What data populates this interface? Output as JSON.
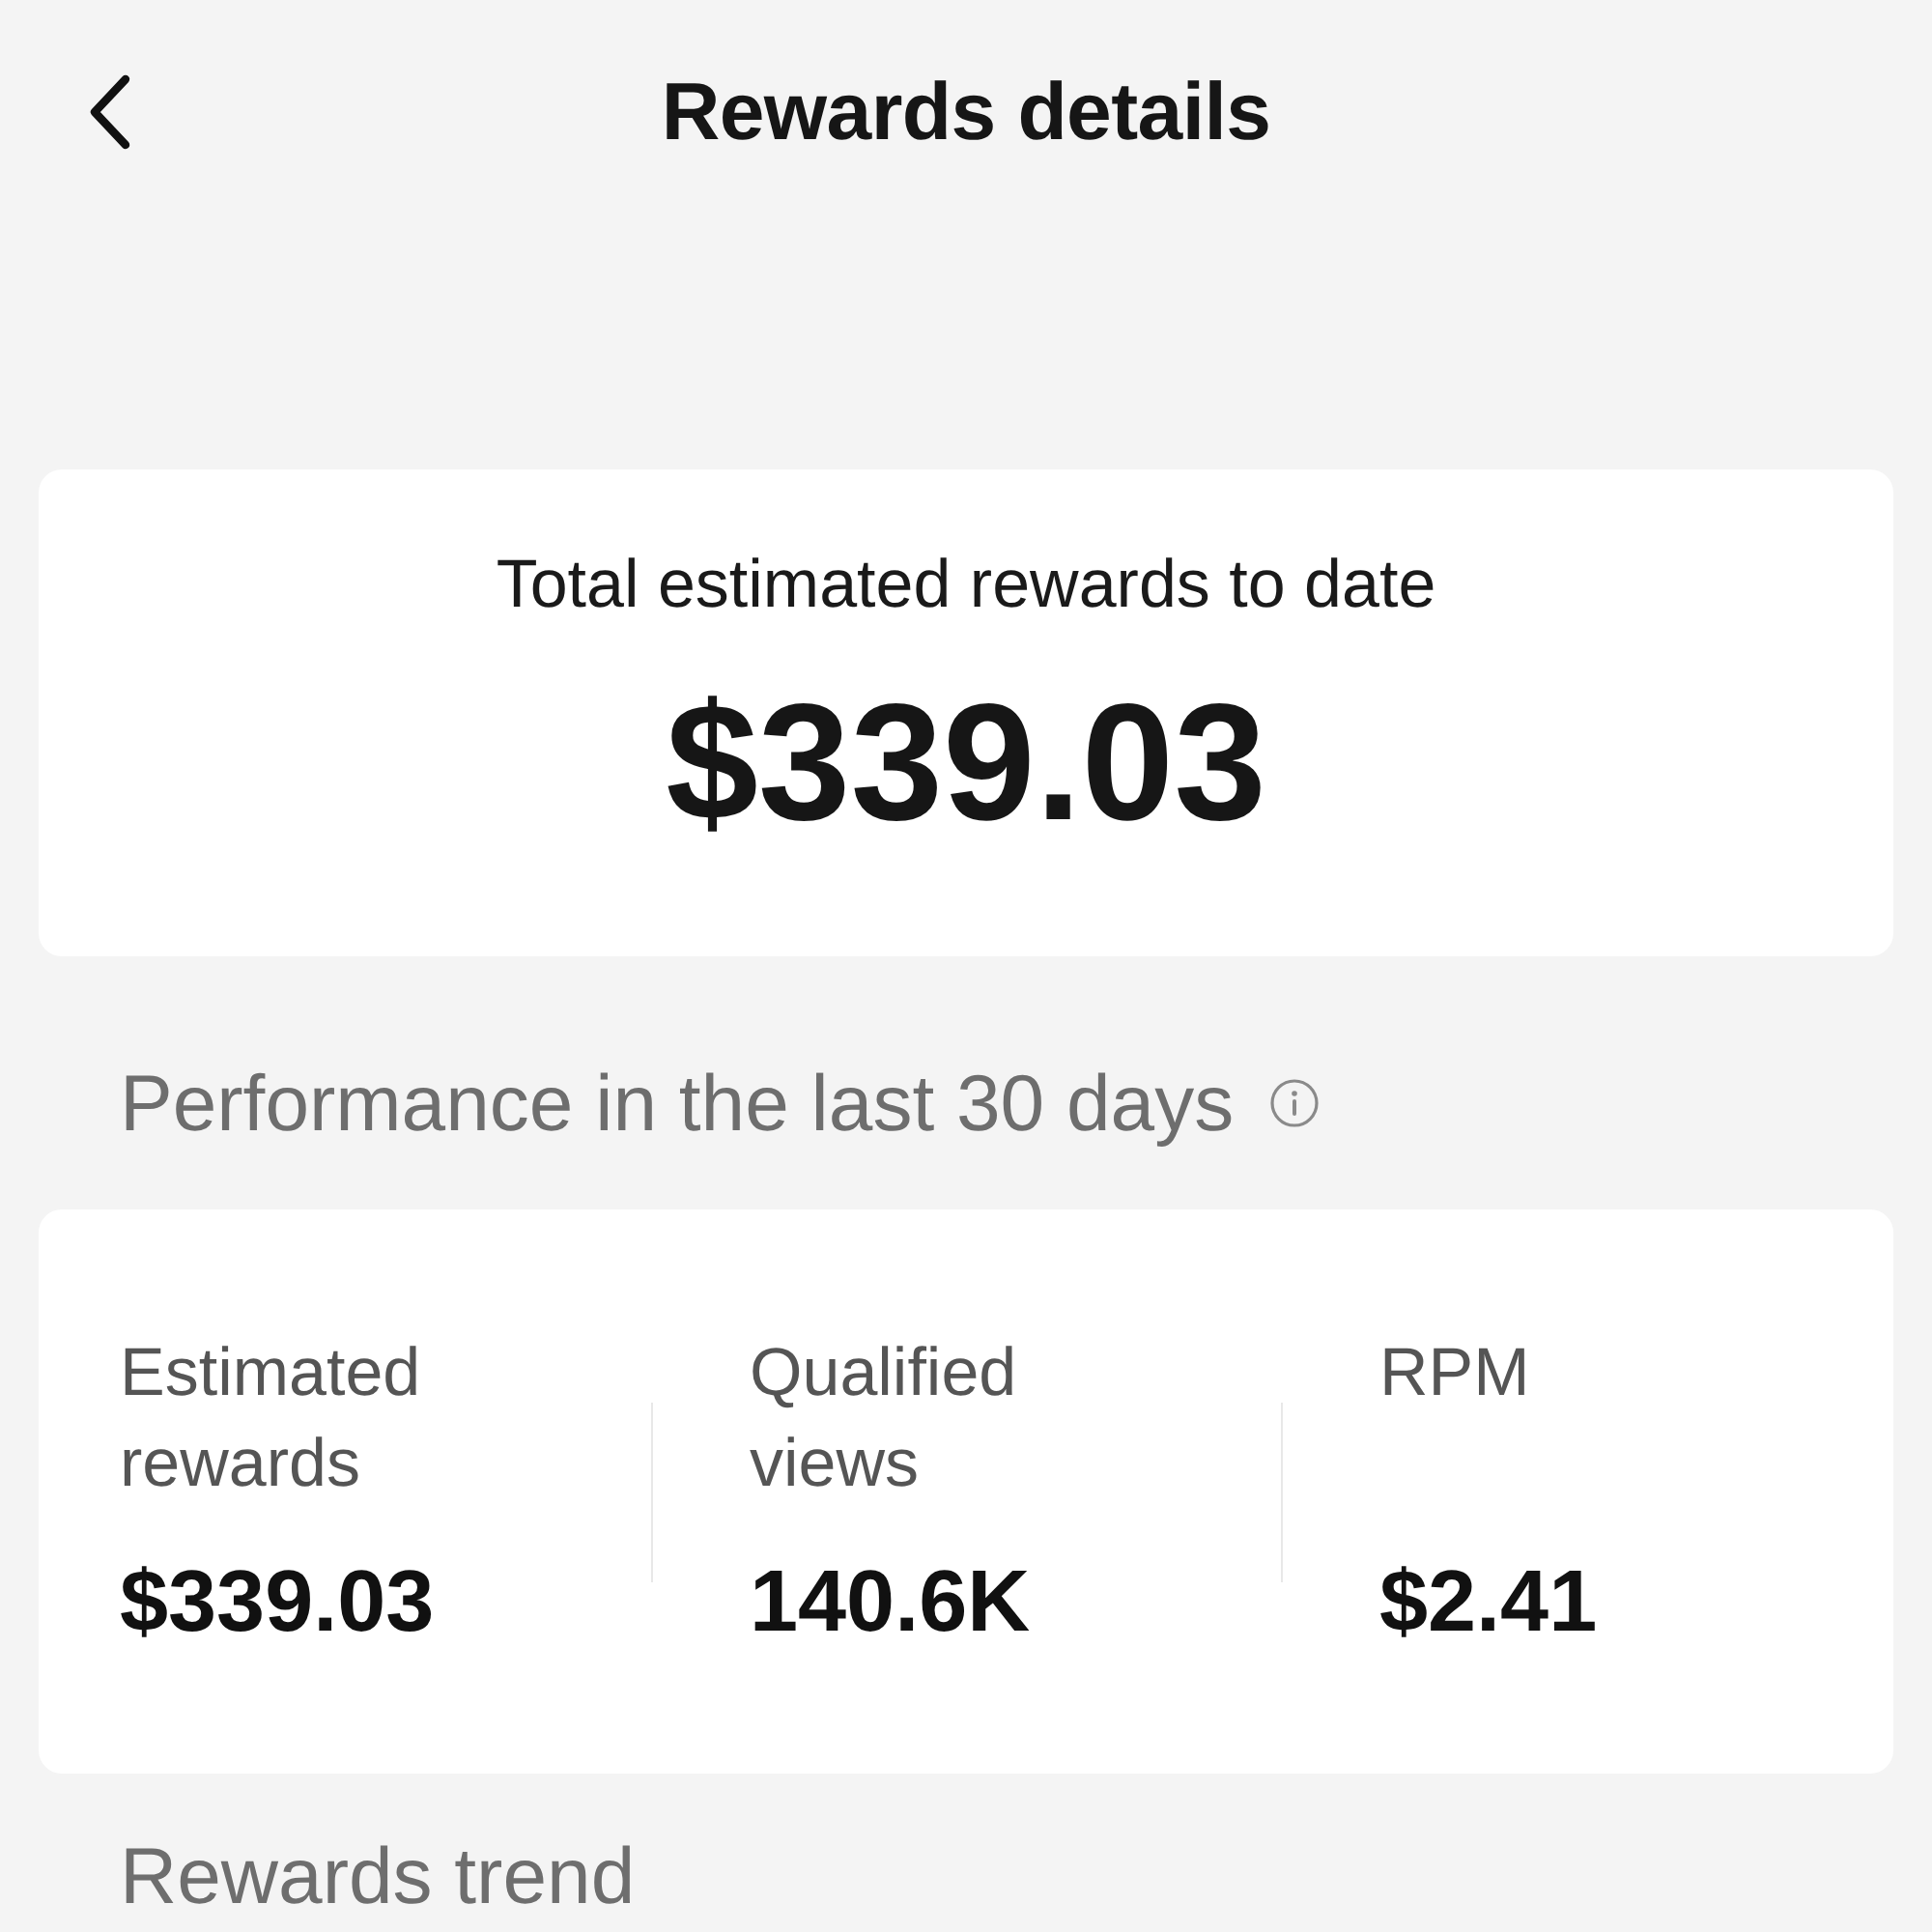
{
  "header": {
    "title": "Rewards details"
  },
  "total_card": {
    "label": "Total estimated rewards to date",
    "amount": "$339.03"
  },
  "performance": {
    "heading": "Performance in the last 30 days",
    "metrics": [
      {
        "label": "Estimated rewards",
        "value": "$339.03"
      },
      {
        "label": "Qualified views",
        "value": "140.6K"
      },
      {
        "label": "RPM",
        "value": "$2.41"
      }
    ]
  },
  "trend": {
    "heading": "Rewards trend"
  }
}
